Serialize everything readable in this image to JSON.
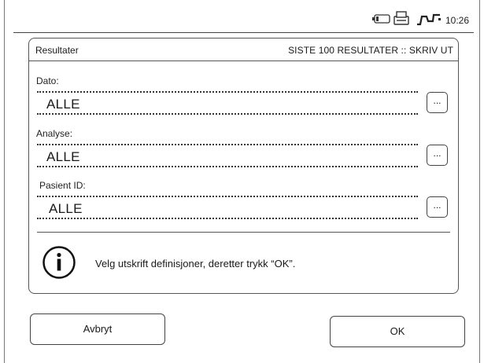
{
  "status_bar": {
    "time": "10:26",
    "icons": [
      "battery-icon",
      "printer-icon",
      "signal-icon"
    ]
  },
  "panel": {
    "title": "Resultater",
    "breadcrumb": "SISTE 100 RESULTATER :: SKRIV UT",
    "fields": [
      {
        "label": "Dato:",
        "value": "ALLE",
        "button_label": "..."
      },
      {
        "label": "Analyse:",
        "value": "ALLE",
        "button_label": "..."
      },
      {
        "label": "Pasient ID:",
        "value": "ALLE",
        "button_label": "..."
      }
    ],
    "info": {
      "icon": "info-icon",
      "text": "Velg utskrift definisjoner, deretter trykk “OK”."
    }
  },
  "buttons": {
    "cancel_label": "Avbryt",
    "ok_label": "OK"
  }
}
